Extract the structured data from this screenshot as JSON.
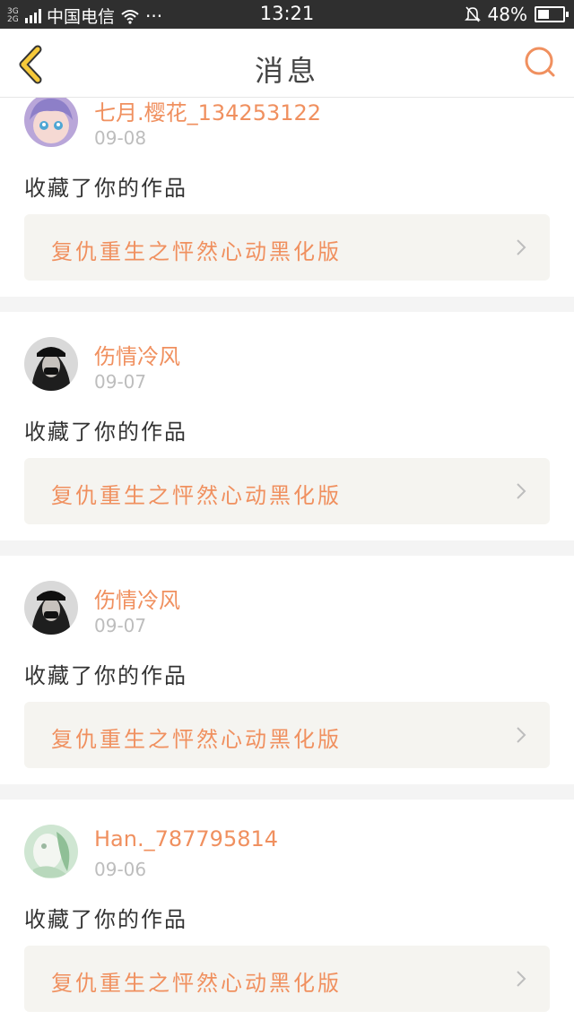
{
  "status_bar": {
    "network_top": "3G",
    "network_bottom": "2G",
    "carrier": "中国电信",
    "more": "···",
    "time": "13:21",
    "battery_percent_label": "48%",
    "battery_level": 0.48,
    "icons": [
      "signal-icon",
      "wifi-icon",
      "mute-bell-icon",
      "battery-icon"
    ]
  },
  "nav": {
    "title": "消息",
    "back_icon": "chevron-left-icon",
    "search_icon": "search-icon",
    "accent_color": "#f6a236",
    "search_color": "#f0905f"
  },
  "messages": [
    {
      "user": "七月.樱花_134253122",
      "date": "09-08",
      "action": "收藏了你的作品",
      "work": "复仇重生之怦然心动黑化版",
      "avatar": "anime-girl-avatar"
    },
    {
      "user": "伤情冷风",
      "date": "09-07",
      "action": "收藏了你的作品",
      "work": "复仇重生之怦然心动黑化版",
      "avatar": "dark-hair-avatar"
    },
    {
      "user": "伤情冷风",
      "date": "09-07",
      "action": "收藏了你的作品",
      "work": "复仇重生之怦然心动黑化版",
      "avatar": "dark-hair-avatar"
    },
    {
      "user": "Han._787795814",
      "date": "09-06",
      "action": "收藏了你的作品",
      "work": "复仇重生之怦然心动黑化版",
      "avatar": "green-white-avatar"
    }
  ],
  "colors": {
    "orange_text": "#f0905f",
    "card_bg": "#ffffff",
    "work_bg": "#f5f4f0",
    "page_bg": "#f4f4f4"
  }
}
